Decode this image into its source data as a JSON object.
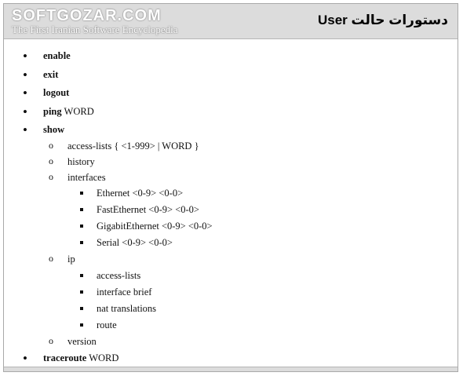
{
  "watermark": {
    "brand": "SOFTGOZAR.COM",
    "tagline": "The First Iranian Software Encyclopedia"
  },
  "title": "دستورات حالت User",
  "commands": {
    "enable": "enable",
    "exit": "exit",
    "logout": "logout",
    "ping": {
      "cmd": "ping",
      "arg": " WORD"
    },
    "show": {
      "cmd": "show",
      "access_lists": "access-lists { <1-999> | WORD }",
      "history": "history",
      "interfaces": {
        "label": "interfaces",
        "items": [
          "Ethernet <0-9> <0-0>",
          "FastEthernet <0-9> <0-0>",
          "GigabitEthernet <0-9> <0-0>",
          "Serial <0-9> <0-0>"
        ]
      },
      "ip": {
        "label": "ip",
        "items": [
          "access-lists",
          "interface brief",
          "nat translations",
          "route"
        ]
      },
      "version": "version"
    },
    "traceroute": {
      "cmd": "traceroute",
      "arg": " WORD"
    }
  }
}
